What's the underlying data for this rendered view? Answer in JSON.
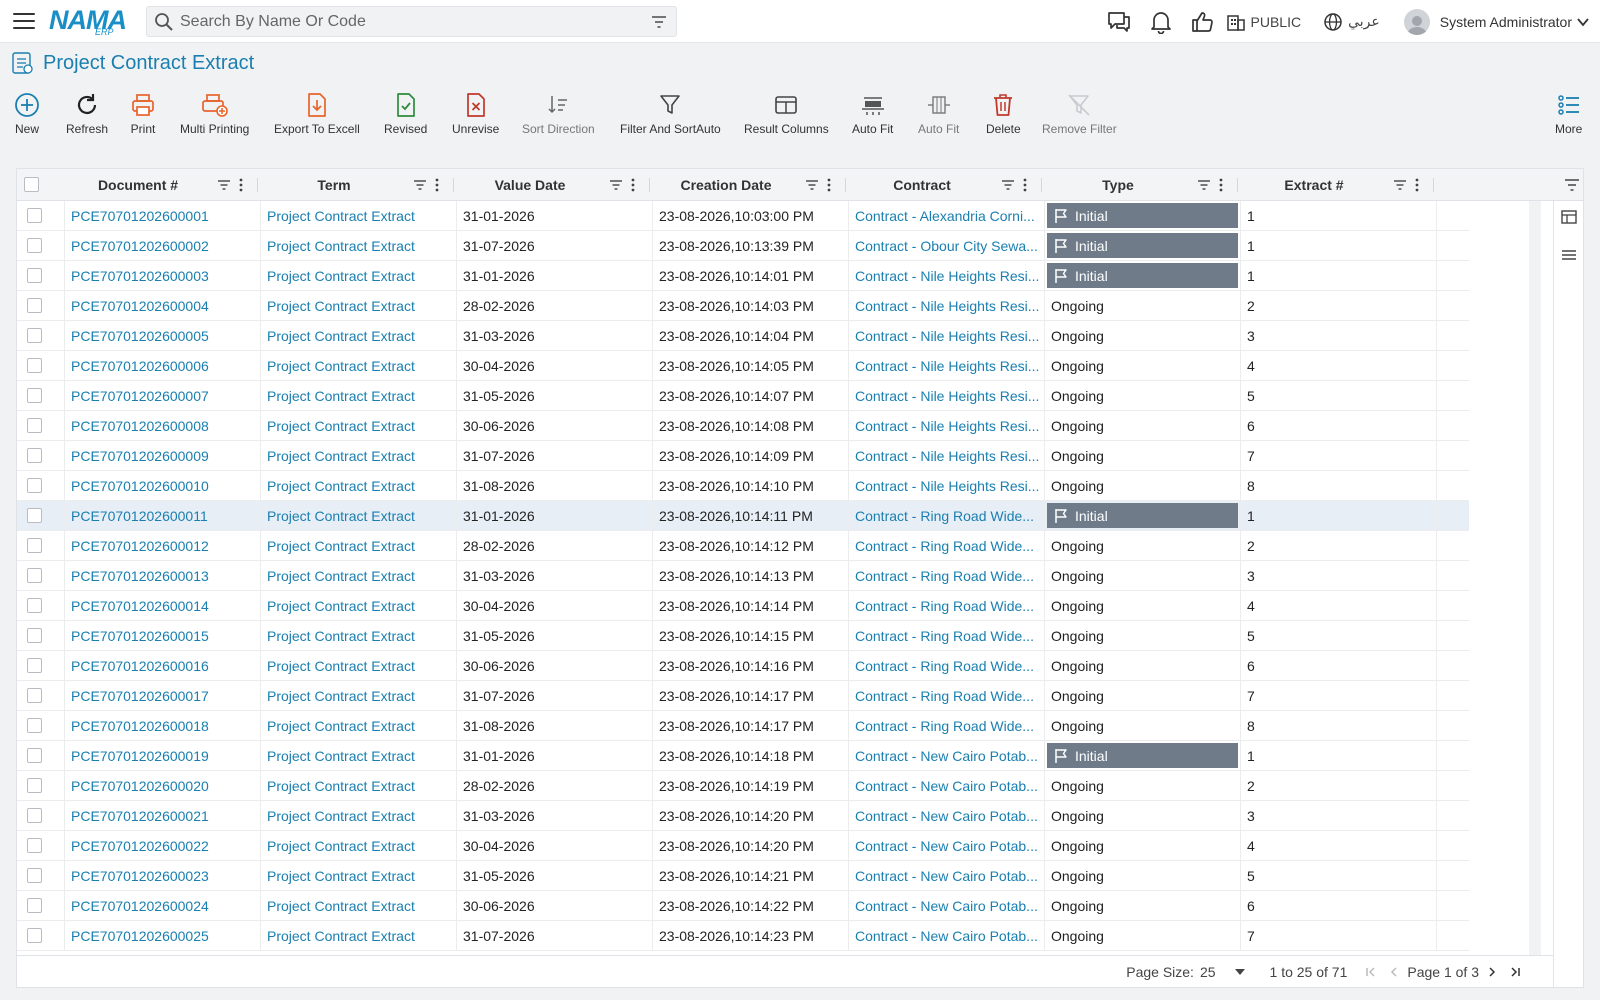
{
  "header": {
    "logo_main": "NAMA",
    "logo_sub": "ERP",
    "search_placeholder": "Search By Name Or Code",
    "branch": "PUBLIC",
    "language": "عربي",
    "user": "System Administrator"
  },
  "page": {
    "title": "Project Contract Extract"
  },
  "toolbar": {
    "new": "New",
    "refresh": "Refresh",
    "print": "Print",
    "multi_printing": "Multi Printing",
    "export_excel": "Export To Excell",
    "revised": "Revised",
    "unrevise": "Unrevise",
    "sort_direction": "Sort Direction",
    "filter_sort_auto": "Filter And SortAuto",
    "result_columns": "Result Columns",
    "auto_fit_1": "Auto Fit",
    "auto_fit_2": "Auto Fit",
    "delete": "Delete",
    "remove_filter": "Remove Filter",
    "more": "More"
  },
  "grid": {
    "columns": [
      "Document #",
      "Term",
      "Value Date",
      "Creation Date",
      "Contract",
      "Type",
      "Extract #"
    ],
    "rows": [
      {
        "doc": "PCE70701202600001",
        "term": "Project Contract Extract",
        "value_date": "31-01-2026",
        "creation": "23-08-2026,10:03:00 PM",
        "contract": "Contract - Alexandria Corni...",
        "type": "Initial",
        "extract": "1"
      },
      {
        "doc": "PCE70701202600002",
        "term": "Project Contract Extract",
        "value_date": "31-07-2026",
        "creation": "23-08-2026,10:13:39 PM",
        "contract": "Contract - Obour City Sewa...",
        "type": "Initial",
        "extract": "1"
      },
      {
        "doc": "PCE70701202600003",
        "term": "Project Contract Extract",
        "value_date": "31-01-2026",
        "creation": "23-08-2026,10:14:01 PM",
        "contract": "Contract - Nile Heights Resi...",
        "type": "Initial",
        "extract": "1"
      },
      {
        "doc": "PCE70701202600004",
        "term": "Project Contract Extract",
        "value_date": "28-02-2026",
        "creation": "23-08-2026,10:14:03 PM",
        "contract": "Contract - Nile Heights Resi...",
        "type": "Ongoing",
        "extract": "2"
      },
      {
        "doc": "PCE70701202600005",
        "term": "Project Contract Extract",
        "value_date": "31-03-2026",
        "creation": "23-08-2026,10:14:04 PM",
        "contract": "Contract - Nile Heights Resi...",
        "type": "Ongoing",
        "extract": "3"
      },
      {
        "doc": "PCE70701202600006",
        "term": "Project Contract Extract",
        "value_date": "30-04-2026",
        "creation": "23-08-2026,10:14:05 PM",
        "contract": "Contract - Nile Heights Resi...",
        "type": "Ongoing",
        "extract": "4"
      },
      {
        "doc": "PCE70701202600007",
        "term": "Project Contract Extract",
        "value_date": "31-05-2026",
        "creation": "23-08-2026,10:14:07 PM",
        "contract": "Contract - Nile Heights Resi...",
        "type": "Ongoing",
        "extract": "5"
      },
      {
        "doc": "PCE70701202600008",
        "term": "Project Contract Extract",
        "value_date": "30-06-2026",
        "creation": "23-08-2026,10:14:08 PM",
        "contract": "Contract - Nile Heights Resi...",
        "type": "Ongoing",
        "extract": "6"
      },
      {
        "doc": "PCE70701202600009",
        "term": "Project Contract Extract",
        "value_date": "31-07-2026",
        "creation": "23-08-2026,10:14:09 PM",
        "contract": "Contract - Nile Heights Resi...",
        "type": "Ongoing",
        "extract": "7"
      },
      {
        "doc": "PCE70701202600010",
        "term": "Project Contract Extract",
        "value_date": "31-08-2026",
        "creation": "23-08-2026,10:14:10 PM",
        "contract": "Contract - Nile Heights Resi...",
        "type": "Ongoing",
        "extract": "8"
      },
      {
        "doc": "PCE70701202600011",
        "term": "Project Contract Extract",
        "value_date": "31-01-2026",
        "creation": "23-08-2026,10:14:11 PM",
        "contract": "Contract - Ring Road Wide...",
        "type": "Initial",
        "extract": "1",
        "selected": true
      },
      {
        "doc": "PCE70701202600012",
        "term": "Project Contract Extract",
        "value_date": "28-02-2026",
        "creation": "23-08-2026,10:14:12 PM",
        "contract": "Contract - Ring Road Wide...",
        "type": "Ongoing",
        "extract": "2"
      },
      {
        "doc": "PCE70701202600013",
        "term": "Project Contract Extract",
        "value_date": "31-03-2026",
        "creation": "23-08-2026,10:14:13 PM",
        "contract": "Contract - Ring Road Wide...",
        "type": "Ongoing",
        "extract": "3"
      },
      {
        "doc": "PCE70701202600014",
        "term": "Project Contract Extract",
        "value_date": "30-04-2026",
        "creation": "23-08-2026,10:14:14 PM",
        "contract": "Contract - Ring Road Wide...",
        "type": "Ongoing",
        "extract": "4"
      },
      {
        "doc": "PCE70701202600015",
        "term": "Project Contract Extract",
        "value_date": "31-05-2026",
        "creation": "23-08-2026,10:14:15 PM",
        "contract": "Contract - Ring Road Wide...",
        "type": "Ongoing",
        "extract": "5"
      },
      {
        "doc": "PCE70701202600016",
        "term": "Project Contract Extract",
        "value_date": "30-06-2026",
        "creation": "23-08-2026,10:14:16 PM",
        "contract": "Contract - Ring Road Wide...",
        "type": "Ongoing",
        "extract": "6"
      },
      {
        "doc": "PCE70701202600017",
        "term": "Project Contract Extract",
        "value_date": "31-07-2026",
        "creation": "23-08-2026,10:14:17 PM",
        "contract": "Contract - Ring Road Wide...",
        "type": "Ongoing",
        "extract": "7"
      },
      {
        "doc": "PCE70701202600018",
        "term": "Project Contract Extract",
        "value_date": "31-08-2026",
        "creation": "23-08-2026,10:14:17 PM",
        "contract": "Contract - Ring Road Wide...",
        "type": "Ongoing",
        "extract": "8"
      },
      {
        "doc": "PCE70701202600019",
        "term": "Project Contract Extract",
        "value_date": "31-01-2026",
        "creation": "23-08-2026,10:14:18 PM",
        "contract": "Contract - New Cairo Potab...",
        "type": "Initial",
        "extract": "1"
      },
      {
        "doc": "PCE70701202600020",
        "term": "Project Contract Extract",
        "value_date": "28-02-2026",
        "creation": "23-08-2026,10:14:19 PM",
        "contract": "Contract - New Cairo Potab...",
        "type": "Ongoing",
        "extract": "2"
      },
      {
        "doc": "PCE70701202600021",
        "term": "Project Contract Extract",
        "value_date": "31-03-2026",
        "creation": "23-08-2026,10:14:20 PM",
        "contract": "Contract - New Cairo Potab...",
        "type": "Ongoing",
        "extract": "3"
      },
      {
        "doc": "PCE70701202600022",
        "term": "Project Contract Extract",
        "value_date": "30-04-2026",
        "creation": "23-08-2026,10:14:20 PM",
        "contract": "Contract - New Cairo Potab...",
        "type": "Ongoing",
        "extract": "4"
      },
      {
        "doc": "PCE70701202600023",
        "term": "Project Contract Extract",
        "value_date": "31-05-2026",
        "creation": "23-08-2026,10:14:21 PM",
        "contract": "Contract - New Cairo Potab...",
        "type": "Ongoing",
        "extract": "5"
      },
      {
        "doc": "PCE70701202600024",
        "term": "Project Contract Extract",
        "value_date": "30-06-2026",
        "creation": "23-08-2026,10:14:22 PM",
        "contract": "Contract - New Cairo Potab...",
        "type": "Ongoing",
        "extract": "6"
      },
      {
        "doc": "PCE70701202600025",
        "term": "Project Contract Extract",
        "value_date": "31-07-2026",
        "creation": "23-08-2026,10:14:23 PM",
        "contract": "Contract - New Cairo Potab...",
        "type": "Ongoing",
        "extract": "7"
      }
    ]
  },
  "footer": {
    "page_size_label": "Page Size:",
    "page_size": "25",
    "range": "1 to 25 of 71",
    "page_label": "Page 1 of 3"
  },
  "colors": {
    "brand": "#1a8fc7",
    "link": "#1a7fb0",
    "initial_badge": "#707b89",
    "selected_row": "#e8eef6"
  }
}
